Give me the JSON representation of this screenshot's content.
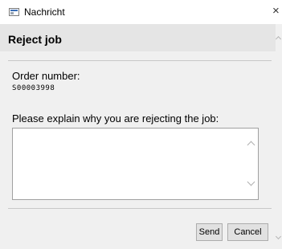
{
  "window": {
    "title": "Nachricht",
    "close_glyph": "×",
    "icon": "app-window-icon"
  },
  "dialog": {
    "title": "Reject job",
    "order_label": "Order number:",
    "order_number": "S00003998",
    "reason_label": "Please explain why you are rejecting the job:",
    "reason_value": ""
  },
  "buttons": {
    "send": "Send",
    "cancel": "Cancel"
  }
}
